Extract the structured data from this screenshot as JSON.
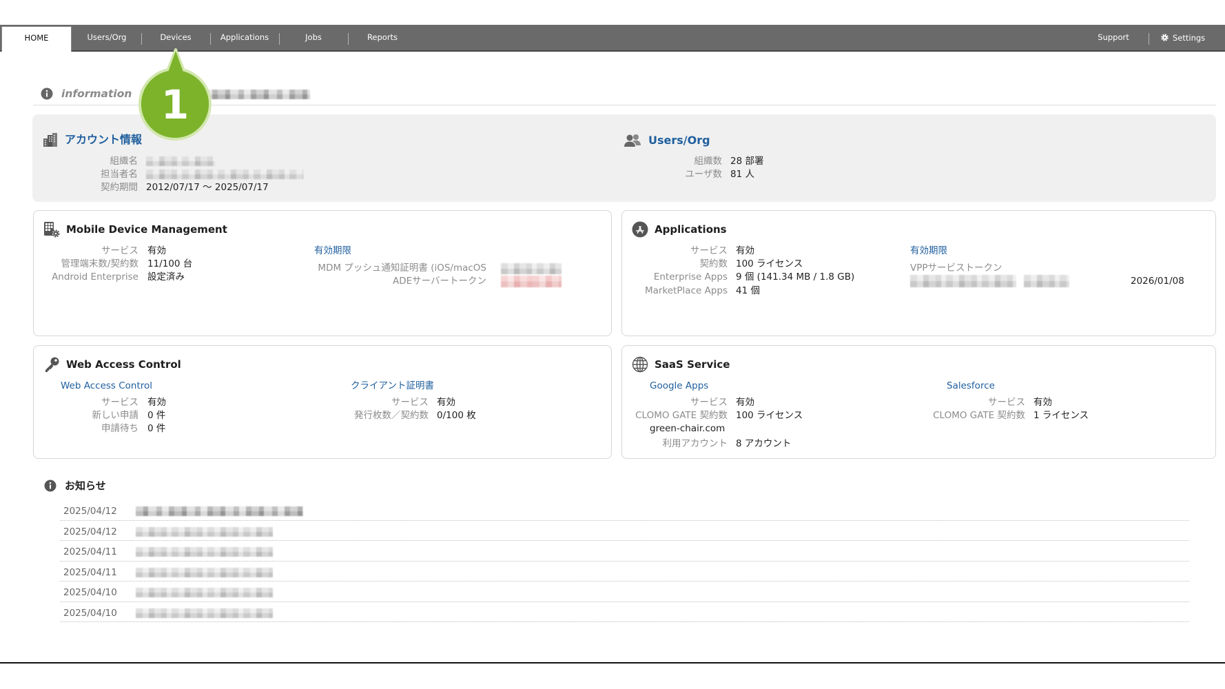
{
  "nav": {
    "tabs": [
      {
        "label": "HOME"
      },
      {
        "label": "Users/Org"
      },
      {
        "label": "Devices"
      },
      {
        "label": "Applications"
      },
      {
        "label": "Jobs"
      },
      {
        "label": "Reports"
      }
    ],
    "active_tab": "HOME",
    "support_label": "Support",
    "settings_label": "Settings"
  },
  "callout": {
    "number": "1"
  },
  "information": {
    "heading": "information"
  },
  "account": {
    "title": "アカウント情報",
    "rows": [
      {
        "label": "組織名"
      },
      {
        "label": "担当者名"
      },
      {
        "label": "契約期間",
        "value": "2012/07/17 〜 2025/07/17"
      }
    ]
  },
  "users_org": {
    "title": "Users/Org",
    "rows": [
      {
        "label": "組織数",
        "value": "28 部署"
      },
      {
        "label": "ユーザ数",
        "value": "81 人"
      }
    ]
  },
  "mdm": {
    "title": "Mobile Device Management",
    "rows": [
      {
        "label": "サービス",
        "value": "有効"
      },
      {
        "label": "管理端末数/契約数",
        "value": "11/100 台"
      },
      {
        "label": "Android Enterprise",
        "value": "設定済み"
      }
    ],
    "expiry_heading": "有効期限",
    "expiry_rows": [
      {
        "label": "MDM プッシュ通知証明書 (iOS/macOS"
      },
      {
        "label": "ADEサーバートークン"
      }
    ]
  },
  "applications": {
    "title": "Applications",
    "rows": [
      {
        "label": "サービス",
        "value": "有効"
      },
      {
        "label": "契約数",
        "value": "100 ライセンス"
      },
      {
        "label": "Enterprise Apps",
        "value": "9 個 (141.34 MB / 1.8 GB)"
      },
      {
        "label": "MarketPlace Apps",
        "value": "41 個"
      }
    ],
    "expiry_heading": "有効期限",
    "vpp_label": "VPPサービストークン",
    "vpp_date": "2026/01/08"
  },
  "web_access": {
    "title": "Web Access Control",
    "link": "Web Access Control",
    "rows": [
      {
        "label": "サービス",
        "value": "有効"
      },
      {
        "label": "新しい申請",
        "value": "0 件"
      },
      {
        "label": "申請待ち",
        "value": "0 件"
      }
    ],
    "cert_heading": "クライアント証明書",
    "cert_rows": [
      {
        "label": "サービス",
        "value": "有効"
      },
      {
        "label": "発行枚数／契約数",
        "value": "0/100 枚"
      }
    ]
  },
  "saas": {
    "title": "SaaS Service",
    "google": {
      "heading": "Google Apps",
      "rows": [
        {
          "label": "サービス",
          "value": "有効"
        },
        {
          "label": "CLOMO GATE 契約数",
          "value": "100 ライセンス"
        }
      ],
      "domain": "green-chair.com",
      "accounts": {
        "label": "利用アカウント",
        "value": "8 アカウント"
      }
    },
    "salesforce": {
      "heading": "Salesforce",
      "rows": [
        {
          "label": "サービス",
          "value": "有効"
        },
        {
          "label": "CLOMO GATE 契約数",
          "value": "1 ライセンス"
        }
      ]
    }
  },
  "news": {
    "heading": "お知らせ",
    "items": [
      {
        "date": "2025/04/12"
      },
      {
        "date": "2025/04/12"
      },
      {
        "date": "2025/04/11"
      },
      {
        "date": "2025/04/11"
      },
      {
        "date": "2025/04/10"
      },
      {
        "date": "2025/04/10"
      }
    ]
  },
  "colors": {
    "nav_background": "#6a6a6a",
    "link": "#1f5f9e",
    "callout": "#7cb32b",
    "panel_background": "#f0f0f0"
  }
}
